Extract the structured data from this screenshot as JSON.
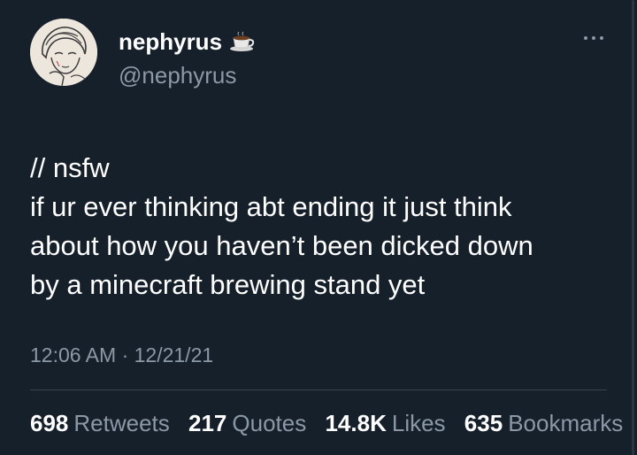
{
  "author": {
    "display_name": "nephyrus",
    "handle": "@nephyrus",
    "name_emoji": "coffee-cup-icon",
    "avatar_icon": "avatar-illustration"
  },
  "tweet": {
    "lines": [
      "// nsfw",
      "if ur ever thinking abt ending it just think",
      "about how you haven’t been dicked down",
      "by a minecraft brewing stand yet"
    ],
    "timestamp": "12:06 AM · 12/21/21"
  },
  "stats": {
    "retweets_count": "698",
    "retweets_label": "Retweets",
    "quotes_count": "217",
    "quotes_label": "Quotes",
    "likes_count": "14.8K",
    "likes_label": "Likes",
    "bookmarks_count": "635",
    "bookmarks_label": "Bookmarks"
  },
  "colors": {
    "background": "#15202b",
    "primary_text": "#ffffff",
    "secondary_text": "#8b98a5",
    "divider": "#38444d"
  },
  "icons": {
    "more": "more-options-icon"
  }
}
